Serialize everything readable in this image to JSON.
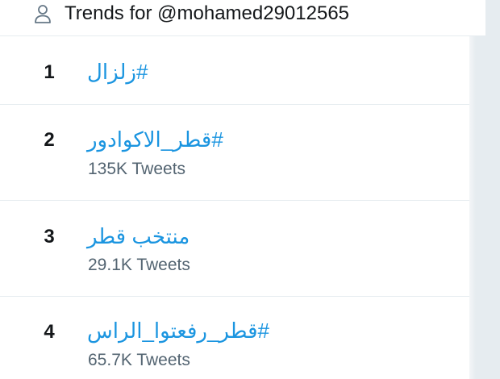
{
  "header": {
    "title": "Trends for @mohamed29012565",
    "icon": "user-icon"
  },
  "colors": {
    "link": "#1b95e0",
    "text": "#14171a",
    "muted": "#536471",
    "divider": "#e6ecf0",
    "background": "#e6ecf0"
  },
  "trends": [
    {
      "rank": "1",
      "label": "زلزال#",
      "count": ""
    },
    {
      "rank": "2",
      "label": "قطر_الاكوادور#",
      "count": "135K Tweets"
    },
    {
      "rank": "3",
      "label": "منتخب قطر",
      "count": "29.1K Tweets"
    },
    {
      "rank": "4",
      "label": "قطر_رفعتوا_الراس#",
      "count": "65.7K Tweets"
    }
  ]
}
